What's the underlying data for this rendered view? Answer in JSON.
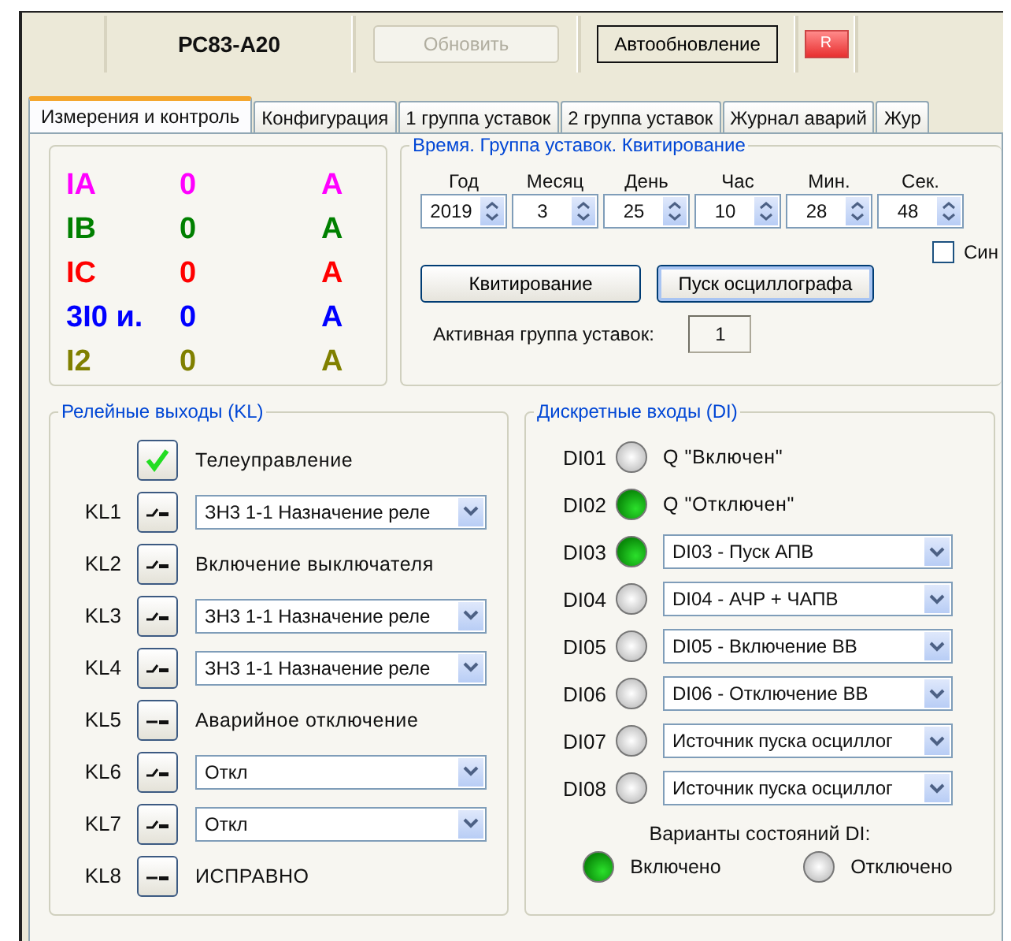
{
  "toolbar": {
    "device": "РС83-А20",
    "refresh_button": {
      "label": "Обновить",
      "disabled": true
    },
    "auto_button": {
      "label": "Автообновление"
    },
    "indicator": {
      "label": "R"
    }
  },
  "tabs": [
    {
      "label": "Измерения и контроль",
      "selected": true
    },
    {
      "label": "Конфигурация",
      "selected": false
    },
    {
      "label": "1 группа уставок",
      "selected": false
    },
    {
      "label": "2 группа уставок",
      "selected": false
    },
    {
      "label": "Журнал аварий",
      "selected": false
    },
    {
      "label": "Жур",
      "selected": false
    }
  ],
  "measurements": [
    {
      "name": "IA",
      "value": "0",
      "unit": "A",
      "color": "#ff00ff"
    },
    {
      "name": "IB",
      "value": "0",
      "unit": "A",
      "color": "#008000"
    },
    {
      "name": "IC",
      "value": "0",
      "unit": "A",
      "color": "#ff0000"
    },
    {
      "name": "3I0 и.",
      "value": "0",
      "unit": "A",
      "color": "#0000ff"
    },
    {
      "name": "I2",
      "value": "0",
      "unit": "A",
      "color": "#808000"
    }
  ],
  "time_group": {
    "title": "Время. Группа уставок. Квитирование",
    "fields": [
      {
        "label": "Год",
        "value": "2019"
      },
      {
        "label": "Месяц",
        "value": "3"
      },
      {
        "label": "День",
        "value": "25"
      },
      {
        "label": "Час",
        "value": "10"
      },
      {
        "label": "Мин.",
        "value": "28"
      },
      {
        "label": "Сек.",
        "value": "48"
      }
    ],
    "sync_checkbox": {
      "label": "Син",
      "checked": false
    },
    "buttons": [
      {
        "label": "Квитирование",
        "focused": false
      },
      {
        "label": "Пуск осциллографа",
        "focused": true
      }
    ],
    "active_group_label": "Активная группа уставок:",
    "active_group": "1"
  },
  "relay_outputs": {
    "title": "Релейные выходы (KL)",
    "items": [
      {
        "kind": "checkbox",
        "label": "Телеуправление",
        "checked": true
      },
      {
        "kind": "select",
        "name": "KL1",
        "closed": false,
        "value": "ЗН3 1-1 Назначение реле"
      },
      {
        "kind": "text",
        "name": "KL2",
        "closed": false,
        "value": "Включение выключателя"
      },
      {
        "kind": "select",
        "name": "KL3",
        "closed": false,
        "value": "ЗН3 1-1 Назначение реле"
      },
      {
        "kind": "select",
        "name": "KL4",
        "closed": false,
        "value": "ЗН3 1-1 Назначение реле"
      },
      {
        "kind": "text",
        "name": "KL5",
        "closed": true,
        "value": "Аварийное отключение"
      },
      {
        "kind": "select",
        "name": "KL6",
        "closed": false,
        "value": "Откл"
      },
      {
        "kind": "select",
        "name": "KL7",
        "closed": false,
        "value": "Откл"
      },
      {
        "kind": "text",
        "name": "KL8",
        "closed": true,
        "value": "ИСПРАВНО"
      }
    ]
  },
  "discrete_inputs": {
    "title": "Дискретные входы (DI)",
    "items": [
      {
        "kind": "text",
        "name": "DI01",
        "on": false,
        "value": "Q \"Включен\""
      },
      {
        "kind": "text",
        "name": "DI02",
        "on": true,
        "value": "Q \"Отключен\""
      },
      {
        "kind": "select",
        "name": "DI03",
        "on": true,
        "value": "DI03 - Пуск АПВ"
      },
      {
        "kind": "select",
        "name": "DI04",
        "on": false,
        "value": "DI04 - АЧР + ЧАПВ"
      },
      {
        "kind": "select",
        "name": "DI05",
        "on": false,
        "value": "DI05 - Включение ВВ"
      },
      {
        "kind": "select",
        "name": "DI06",
        "on": false,
        "value": "DI06 - Отключение ВВ"
      },
      {
        "kind": "select",
        "name": "DI07",
        "on": false,
        "value": "Источник пуска осциллог"
      },
      {
        "kind": "select",
        "name": "DI08",
        "on": false,
        "value": "Источник пуска осциллог"
      }
    ],
    "legend_title": "Варианты состояний DI:",
    "legend": [
      {
        "label": "Включено",
        "on": true
      },
      {
        "label": "Отключено",
        "on": false
      }
    ]
  }
}
